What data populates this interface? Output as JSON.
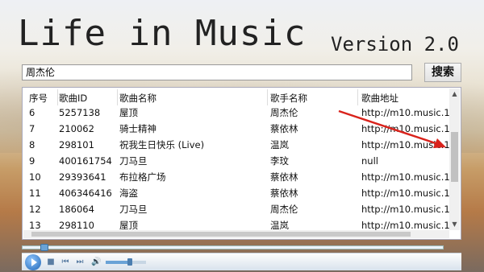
{
  "app": {
    "title": "Life in Music",
    "version": "Version 2.0"
  },
  "search": {
    "value": "周杰伦",
    "button_label": "搜索"
  },
  "table": {
    "columns": [
      "序号",
      "歌曲ID",
      "歌曲名称",
      "歌手名称",
      "歌曲地址"
    ],
    "rows": [
      [
        "6",
        "5257138",
        "屋顶",
        "周杰伦",
        "http://m10.music.1"
      ],
      [
        "7",
        "210062",
        "骑士精神",
        "蔡依林",
        "http://m10.music.1"
      ],
      [
        "8",
        "298101",
        "祝我生日快乐 (Live)",
        "温岚",
        "http://m10.music.1"
      ],
      [
        "9",
        "400161754",
        "刀马旦",
        "李玟",
        "null"
      ],
      [
        "10",
        "29393641",
        "布拉格广场",
        "蔡依林",
        "http://m10.music.1"
      ],
      [
        "11",
        "406346416",
        "海盗",
        "蔡依林",
        "http://m10.music.1"
      ],
      [
        "12",
        "186064",
        "刀马旦",
        "周杰伦",
        "http://m10.music.1"
      ],
      [
        "13",
        "298110",
        "屋顶",
        "温岚",
        "http://m10.music.1"
      ]
    ]
  },
  "player": {
    "progress": 0.04,
    "volume": 0.6
  },
  "colors": {
    "accent": "#1e64b4",
    "annotation_arrow": "#d9231c"
  }
}
